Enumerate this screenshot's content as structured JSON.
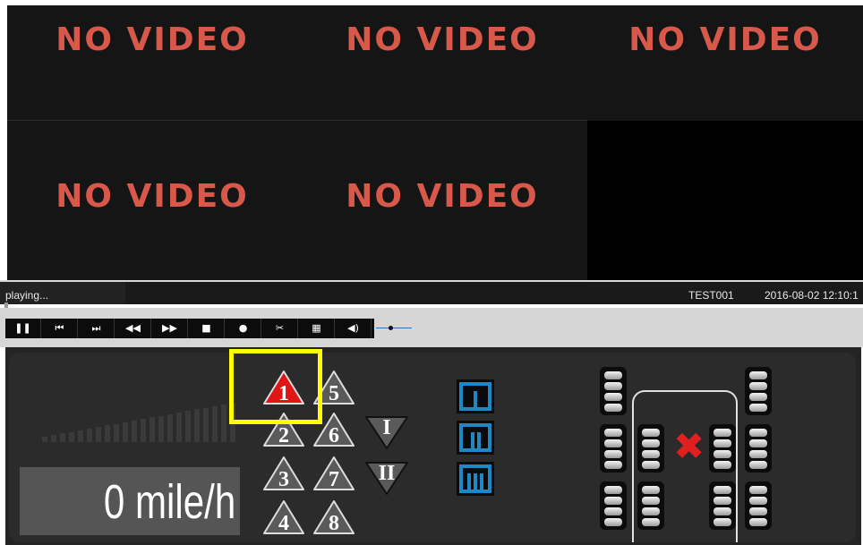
{
  "video_tiles": [
    {
      "label": "NO VIDEO"
    },
    {
      "label": "NO VIDEO"
    },
    {
      "label": "NO VIDEO"
    },
    {
      "label": "NO VIDEO"
    },
    {
      "label": "NO VIDEO"
    },
    {
      "label": ""
    }
  ],
  "status": {
    "text": "playing...",
    "device": "TEST001",
    "datetime": "2016-08-02 12:10:1"
  },
  "toolbar": {
    "buttons": [
      {
        "name": "pause",
        "glyph": "❚❚"
      },
      {
        "name": "previous",
        "glyph": "⏮"
      },
      {
        "name": "next",
        "glyph": "⏭"
      },
      {
        "name": "rewind",
        "glyph": "◀◀"
      },
      {
        "name": "fast-forward",
        "glyph": "▶▶"
      },
      {
        "name": "stop",
        "glyph": "■"
      },
      {
        "name": "record",
        "glyph": "●"
      },
      {
        "name": "clip",
        "glyph": "✂"
      },
      {
        "name": "layout",
        "glyph": "▦"
      },
      {
        "name": "volume",
        "glyph": "◀)"
      }
    ],
    "volume_level": 0.35
  },
  "speed": {
    "value": "0 mile/h",
    "level": 0
  },
  "channels": [
    "1",
    "2",
    "3",
    "4",
    "5",
    "6",
    "7",
    "8"
  ],
  "active_channel": "1",
  "groups": [
    "I",
    "II"
  ],
  "modes": [
    "I",
    "II",
    "III"
  ],
  "colors": {
    "no_video_text": "#d8584a",
    "active_channel": "#e01515",
    "inactive_channel": "#5a5a5a",
    "mode_button": "#1e88c7",
    "highlight": "#ffff00",
    "alarm_x": "#e02020"
  },
  "icons": {
    "tire_alarm": "red-x-icon"
  }
}
